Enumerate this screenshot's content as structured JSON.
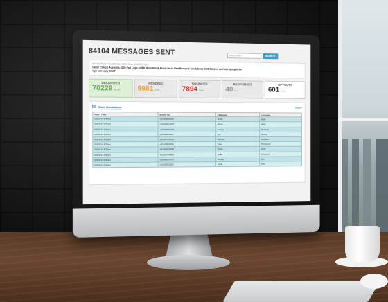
{
  "dashboard": {
    "title": "84104 MESSAGES SENT",
    "search": {
      "placeholder": "Search value",
      "button": "SEARCH"
    },
    "message": {
      "meta": "Sent 2:00pm Thu 6th Mar 2014 from 61400071417",
      "body": "Laser Clinics Australia $129 Full Legs or $59 Brazilian & Arms Laser Hair Removal SALE Ends 30/3 Click to call http://go.gbl/r9tn",
      "optout": "Opt-out reply STOP"
    },
    "stats": [
      {
        "label": "DELIVERED",
        "value": "70229",
        "pct": "83.5%"
      },
      {
        "label": "PENDING",
        "value": "5981",
        "pct": "7.1%"
      },
      {
        "label": "BOUNCED",
        "value": "7894",
        "pct": "9.4%"
      },
      {
        "label": "RESPONSES",
        "value": "40",
        "pct": "0%"
      },
      {
        "label": "OPTOUTS",
        "value": "601",
        "pct": "0.7%"
      }
    ],
    "table": {
      "title": "Stats Breakdown",
      "export": "Export",
      "columns": [
        "Date / Time",
        "Mobile No.",
        "Firstname",
        "Lastname"
      ],
      "rows": [
        [
          "06/03/14 4:46pm",
          "+61403900090",
          "Brittle",
          "Hyde"
        ],
        [
          "06/03/14 4:47pm",
          "+61423017253",
          "Fiona",
          "Hertz"
        ],
        [
          "06/03/14 4:40pm",
          "+61400737725",
          "Juliette",
          "Shuffield"
        ],
        [
          "06/03/14 4:47pm",
          "+61423623007",
          "Lyn",
          "Pearce"
        ],
        [
          "06/03/14 4:38pm",
          "+61400720810",
          "Jessica",
          "Simpson"
        ],
        [
          "06/03/14 4:39pm",
          "+61423004061",
          "Kate",
          "Thompson"
        ],
        [
          "06/03/14 4:38pm",
          "+61400020088",
          "Ruhin",
          "Frost"
        ],
        [
          "06/03/14 4:36pm",
          "+61423749808",
          "Jodie",
          "O'Connor"
        ],
        [
          "06/03/14 4:36pm",
          "+61404070470",
          "Sophie",
          "Bell"
        ],
        [
          "06/03/14 4:34pm",
          "+61403110910",
          "Emily",
          "Reid"
        ]
      ]
    }
  }
}
